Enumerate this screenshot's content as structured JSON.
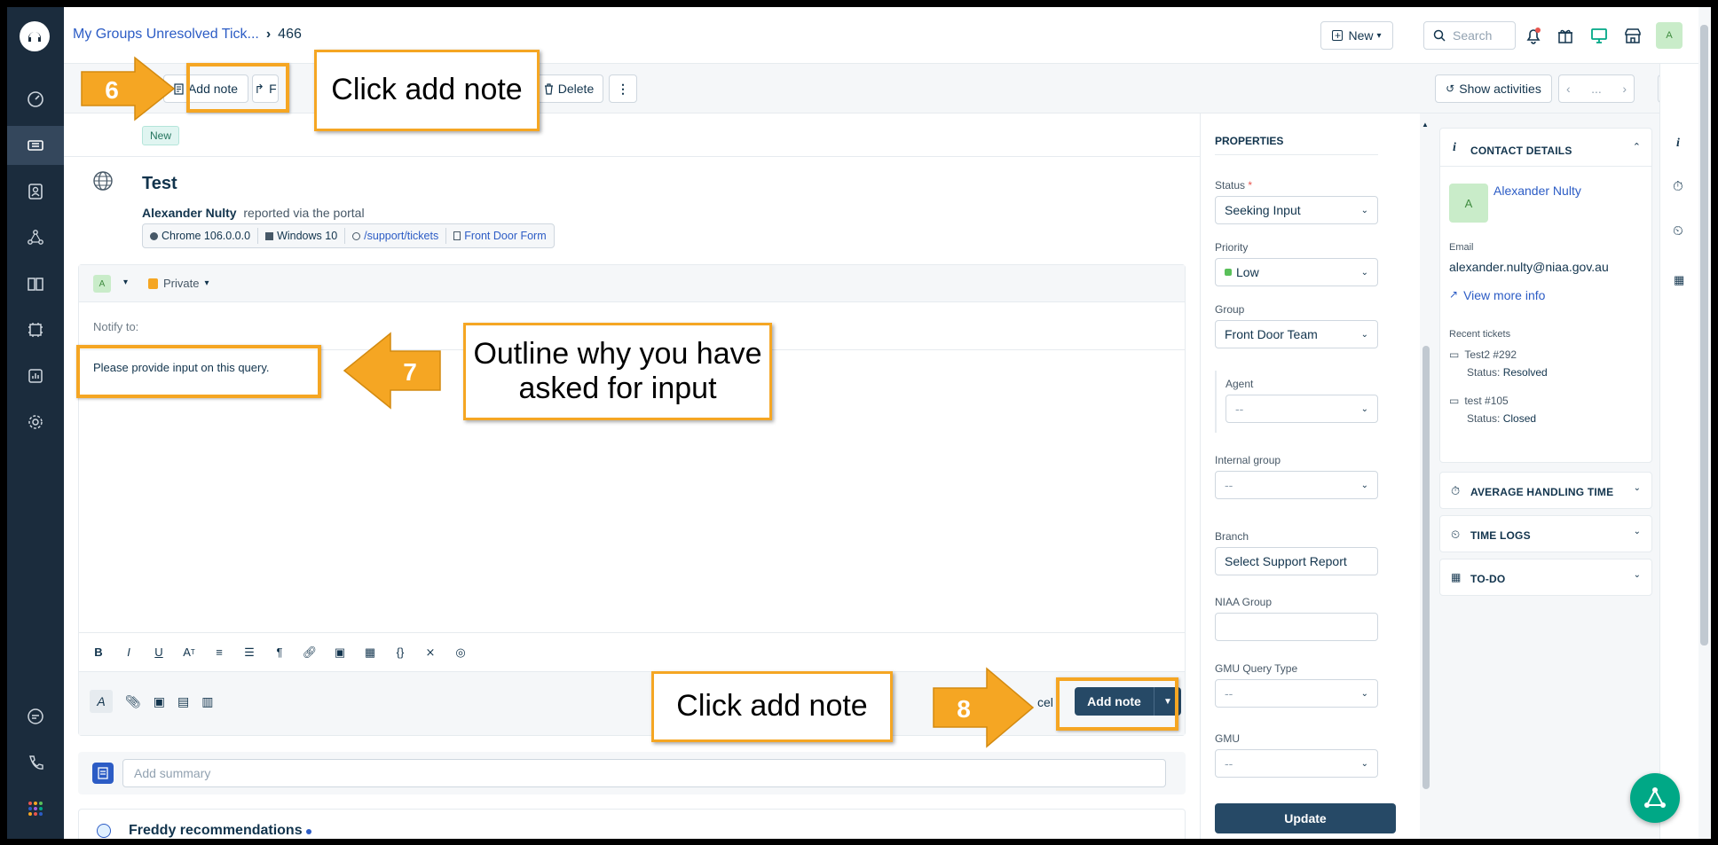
{
  "header": {
    "breadcrumb_view": "My Groups Unresolved Tick...",
    "ticket_number": "466",
    "new_label": "New",
    "search_placeholder": "Search",
    "avatar_initial": "A"
  },
  "toolbar": {
    "add_note_label": "Add note",
    "forward_label": "F",
    "delete_label": "Delete",
    "show_activities_label": "Show activities",
    "nav_more": "..."
  },
  "ticket": {
    "status_badge": "New",
    "subject": "Test",
    "reporter_name": "Alexander Nulty",
    "reporter_suffix": "reported via the portal",
    "meta": {
      "browser": "Chrome 106.0.0.0",
      "os": "Windows 10",
      "url": "/support/tickets",
      "form": "Front Door Form"
    }
  },
  "editor": {
    "author_initial": "A",
    "visibility": "Private",
    "notify_label": "Notify to:",
    "body_text": "Please provide input on this query.",
    "cancel_label": "Cancel",
    "cancel_visible": "cel",
    "add_note_label": "Add note"
  },
  "summary": {
    "placeholder": "Add summary"
  },
  "freddy": {
    "title": "Freddy recommendations"
  },
  "properties": {
    "title": "PROPERTIES",
    "status_label": "Status",
    "status_value": "Seeking Input",
    "priority_label": "Priority",
    "priority_value": "Low",
    "priority_color": "#5ac05a",
    "group_label": "Group",
    "group_value": "Front Door Team",
    "agent_label": "Agent",
    "agent_value": "--",
    "internal_group_label": "Internal group",
    "internal_group_value": "--",
    "branch_label": "Branch",
    "branch_value": "Select Support Report",
    "niaa_group_label": "NIAA Group",
    "gmu_query_type_label": "GMU Query Type",
    "gmu_query_type_value": "--",
    "gmu_label": "GMU",
    "gmu_value": "--",
    "update_label": "Update"
  },
  "contact": {
    "title": "CONTACT DETAILS",
    "avatar_initial": "A",
    "name": "Alexander Nulty",
    "email_label": "Email",
    "email": "alexander.nulty@niaa.gov.au",
    "view_more": "View more info",
    "recent_label": "Recent tickets",
    "recent": [
      {
        "title": "Test2 #292",
        "status_label": "Status:",
        "status": "Resolved"
      },
      {
        "title": "test #105",
        "status_label": "Status:",
        "status": "Closed"
      }
    ],
    "sections": [
      "AVERAGE HANDLING TIME",
      "TIME LOGS",
      "TO-DO"
    ]
  },
  "callouts": {
    "step6_num": "6",
    "step6_text": "Click add note",
    "step7_num": "7",
    "step7_text": "Outline why you have asked for input",
    "step8_num": "8",
    "step8_text": "Click add note"
  },
  "colors": {
    "accent": "#f5a623",
    "nav_bg": "#1b2c3d",
    "primary_btn": "#264966",
    "link": "#2c5cc5"
  }
}
